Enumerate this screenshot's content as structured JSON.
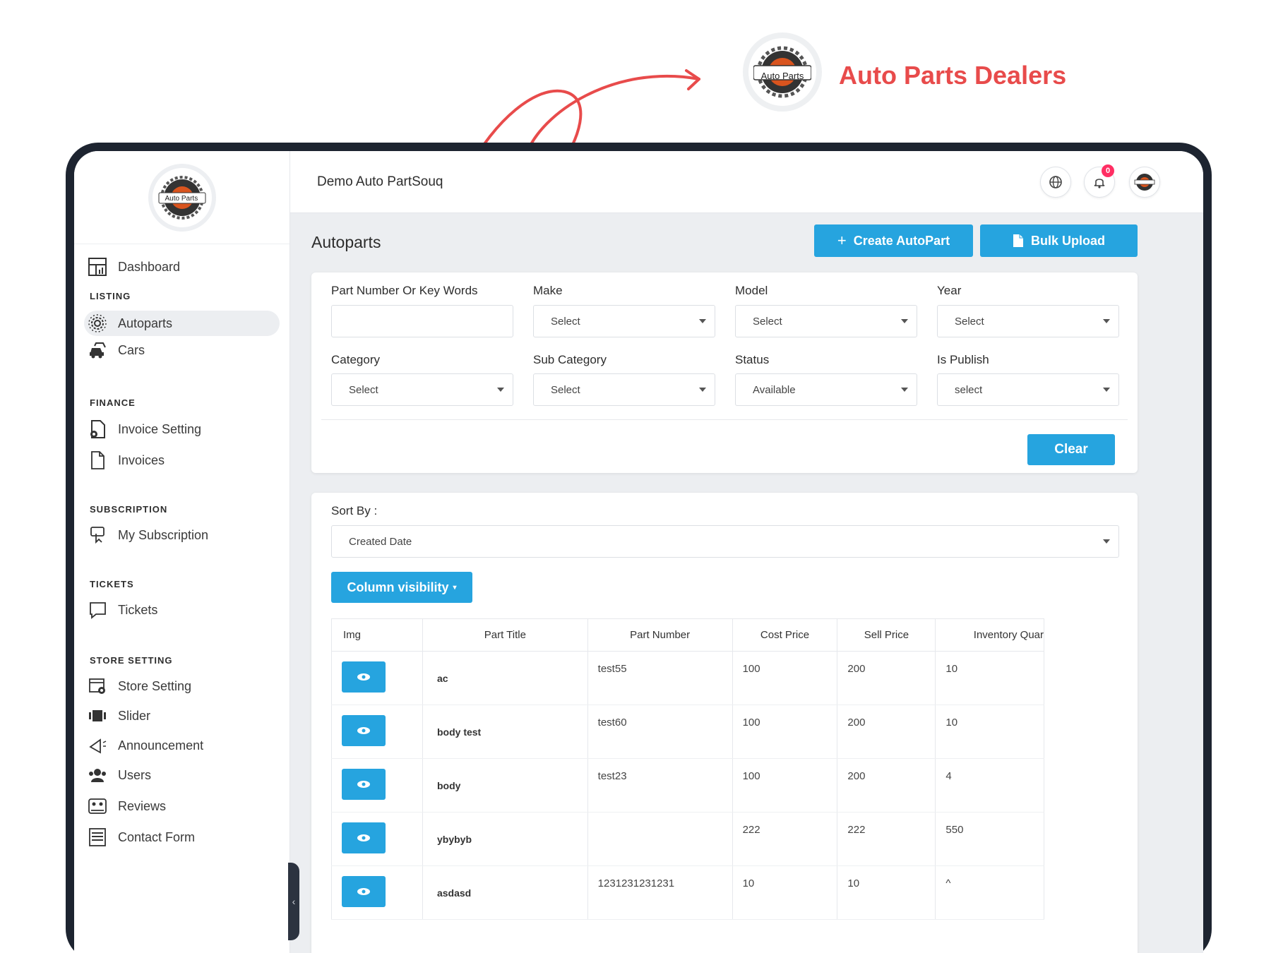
{
  "brand": {
    "title": "Auto Parts Dealers",
    "logo_text": "Auto Parts"
  },
  "header": {
    "store_name": "Demo Auto PartSouq",
    "notification_count": "0"
  },
  "sidebar": {
    "logo_text": "Auto Parts",
    "dashboard": "Dashboard",
    "sections": {
      "listing": "LISTING",
      "finance": "FINANCE",
      "subscription": "SUBSCRIPTION",
      "tickets": "TICKETS",
      "store_setting": "STORE SETTING"
    },
    "items": {
      "autoparts": "Autoparts",
      "cars": "Cars",
      "invoice_setting": "Invoice Setting",
      "invoices": "Invoices",
      "my_subscription": "My Subscription",
      "tickets": "Tickets",
      "store_setting": "Store Setting",
      "slider": "Slider",
      "announcement": "Announcement",
      "users": "Users",
      "reviews": "Reviews",
      "contact_form": "Contact Form"
    }
  },
  "page": {
    "title": "Autoparts",
    "create_button": "Create AutoPart",
    "create_icon": "+",
    "bulk_button": "Bulk Upload"
  },
  "filters": {
    "part_number_label": "Part Number Or Key Words",
    "part_number_value": "",
    "make_label": "Make",
    "make_value": "Select",
    "model_label": "Model",
    "model_value": "Select",
    "year_label": "Year",
    "year_value": "Select",
    "category_label": "Category",
    "category_value": "Select",
    "sub_category_label": "Sub Category",
    "sub_category_value": "Select",
    "status_label": "Status",
    "status_value": "Available",
    "is_publish_label": "Is Publish",
    "is_publish_value": "select",
    "clear_button": "Clear"
  },
  "list": {
    "sort_label": "Sort By :",
    "sort_value": "Created Date",
    "column_visibility": "Column visibility",
    "columns": [
      "Img",
      "Part Title",
      "Part Number",
      "Cost Price",
      "Sell Price",
      "Inventory Quar"
    ],
    "rows": [
      {
        "title": "ac",
        "part_number": "test55",
        "cost": "100",
        "sell": "200",
        "inventory": "10"
      },
      {
        "title": "body test",
        "part_number": "test60",
        "cost": "100",
        "sell": "200",
        "inventory": "10"
      },
      {
        "title": "body",
        "part_number": "test23",
        "cost": "100",
        "sell": "200",
        "inventory": "4"
      },
      {
        "title": "ybybyb",
        "part_number": "",
        "cost": "222",
        "sell": "222",
        "inventory": "550"
      },
      {
        "title": "asdasd",
        "part_number": "1231231231231",
        "cost": "10",
        "sell": "10",
        "inventory": "^"
      }
    ]
  },
  "colors": {
    "accent": "#26a4df",
    "brand_red": "#e84b4b",
    "badge": "#ff2e63",
    "frame": "#1d2430"
  }
}
